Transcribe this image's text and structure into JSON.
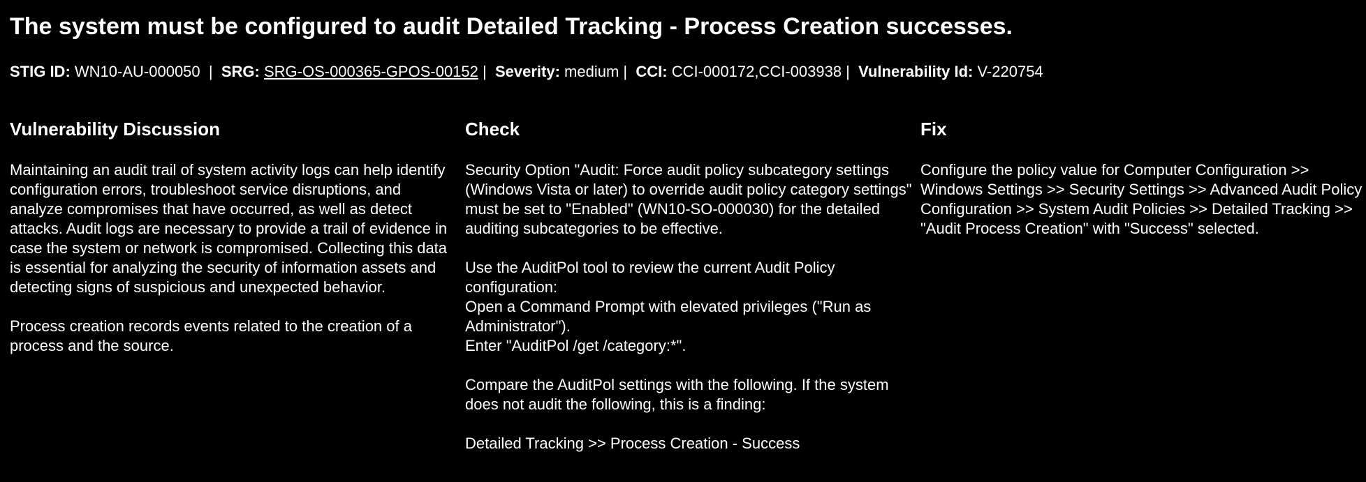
{
  "title": "The system must be configured to audit Detailed Tracking - Process Creation successes.",
  "meta": {
    "stig_id_label": "STIG ID:",
    "stig_id_value": "WN10-AU-000050",
    "srg_label": "SRG:",
    "srg_value": "SRG-OS-000365-GPOS-00152",
    "severity_label": "Severity:",
    "severity_value": "medium",
    "cci_label": "CCI:",
    "cci_value": "CCI-000172,CCI-003938",
    "vuln_id_label": "Vulnerability Id:",
    "vuln_id_value": "V-220754"
  },
  "discussion": {
    "heading": "Vulnerability Discussion",
    "paragraphs": [
      "Maintaining an audit trail of system activity logs can help identify configuration errors, troubleshoot service disruptions, and analyze compromises that have occurred, as well as detect attacks. Audit logs are necessary to provide a trail of evidence in case the system or network is compromised. Collecting this data is essential for analyzing the security of information assets and detecting signs of suspicious and unexpected behavior.",
      "Process creation records events related to the creation of a process and the source."
    ]
  },
  "check": {
    "heading": "Check",
    "paragraphs": [
      "Security Option \"Audit: Force audit policy subcategory settings (Windows Vista or later) to override audit policy category settings\" must be set to \"Enabled\" (WN10-SO-000030) for the detailed auditing subcategories to be effective.",
      "Use the AuditPol tool to review the current Audit Policy configuration:",
      "Open a Command Prompt with elevated privileges (\"Run as Administrator\").",
      "Enter \"AuditPol /get /category:*\".",
      "Compare the AuditPol settings with the following. If the system does not audit the following, this is a finding:",
      "Detailed Tracking >> Process Creation - Success"
    ]
  },
  "fix": {
    "heading": "Fix",
    "paragraphs": [
      "Configure the policy value for Computer Configuration >> Windows Settings >> Security Settings >> Advanced Audit Policy Configuration >> System Audit Policies >> Detailed Tracking >> \"Audit Process Creation\" with \"Success\" selected."
    ]
  }
}
